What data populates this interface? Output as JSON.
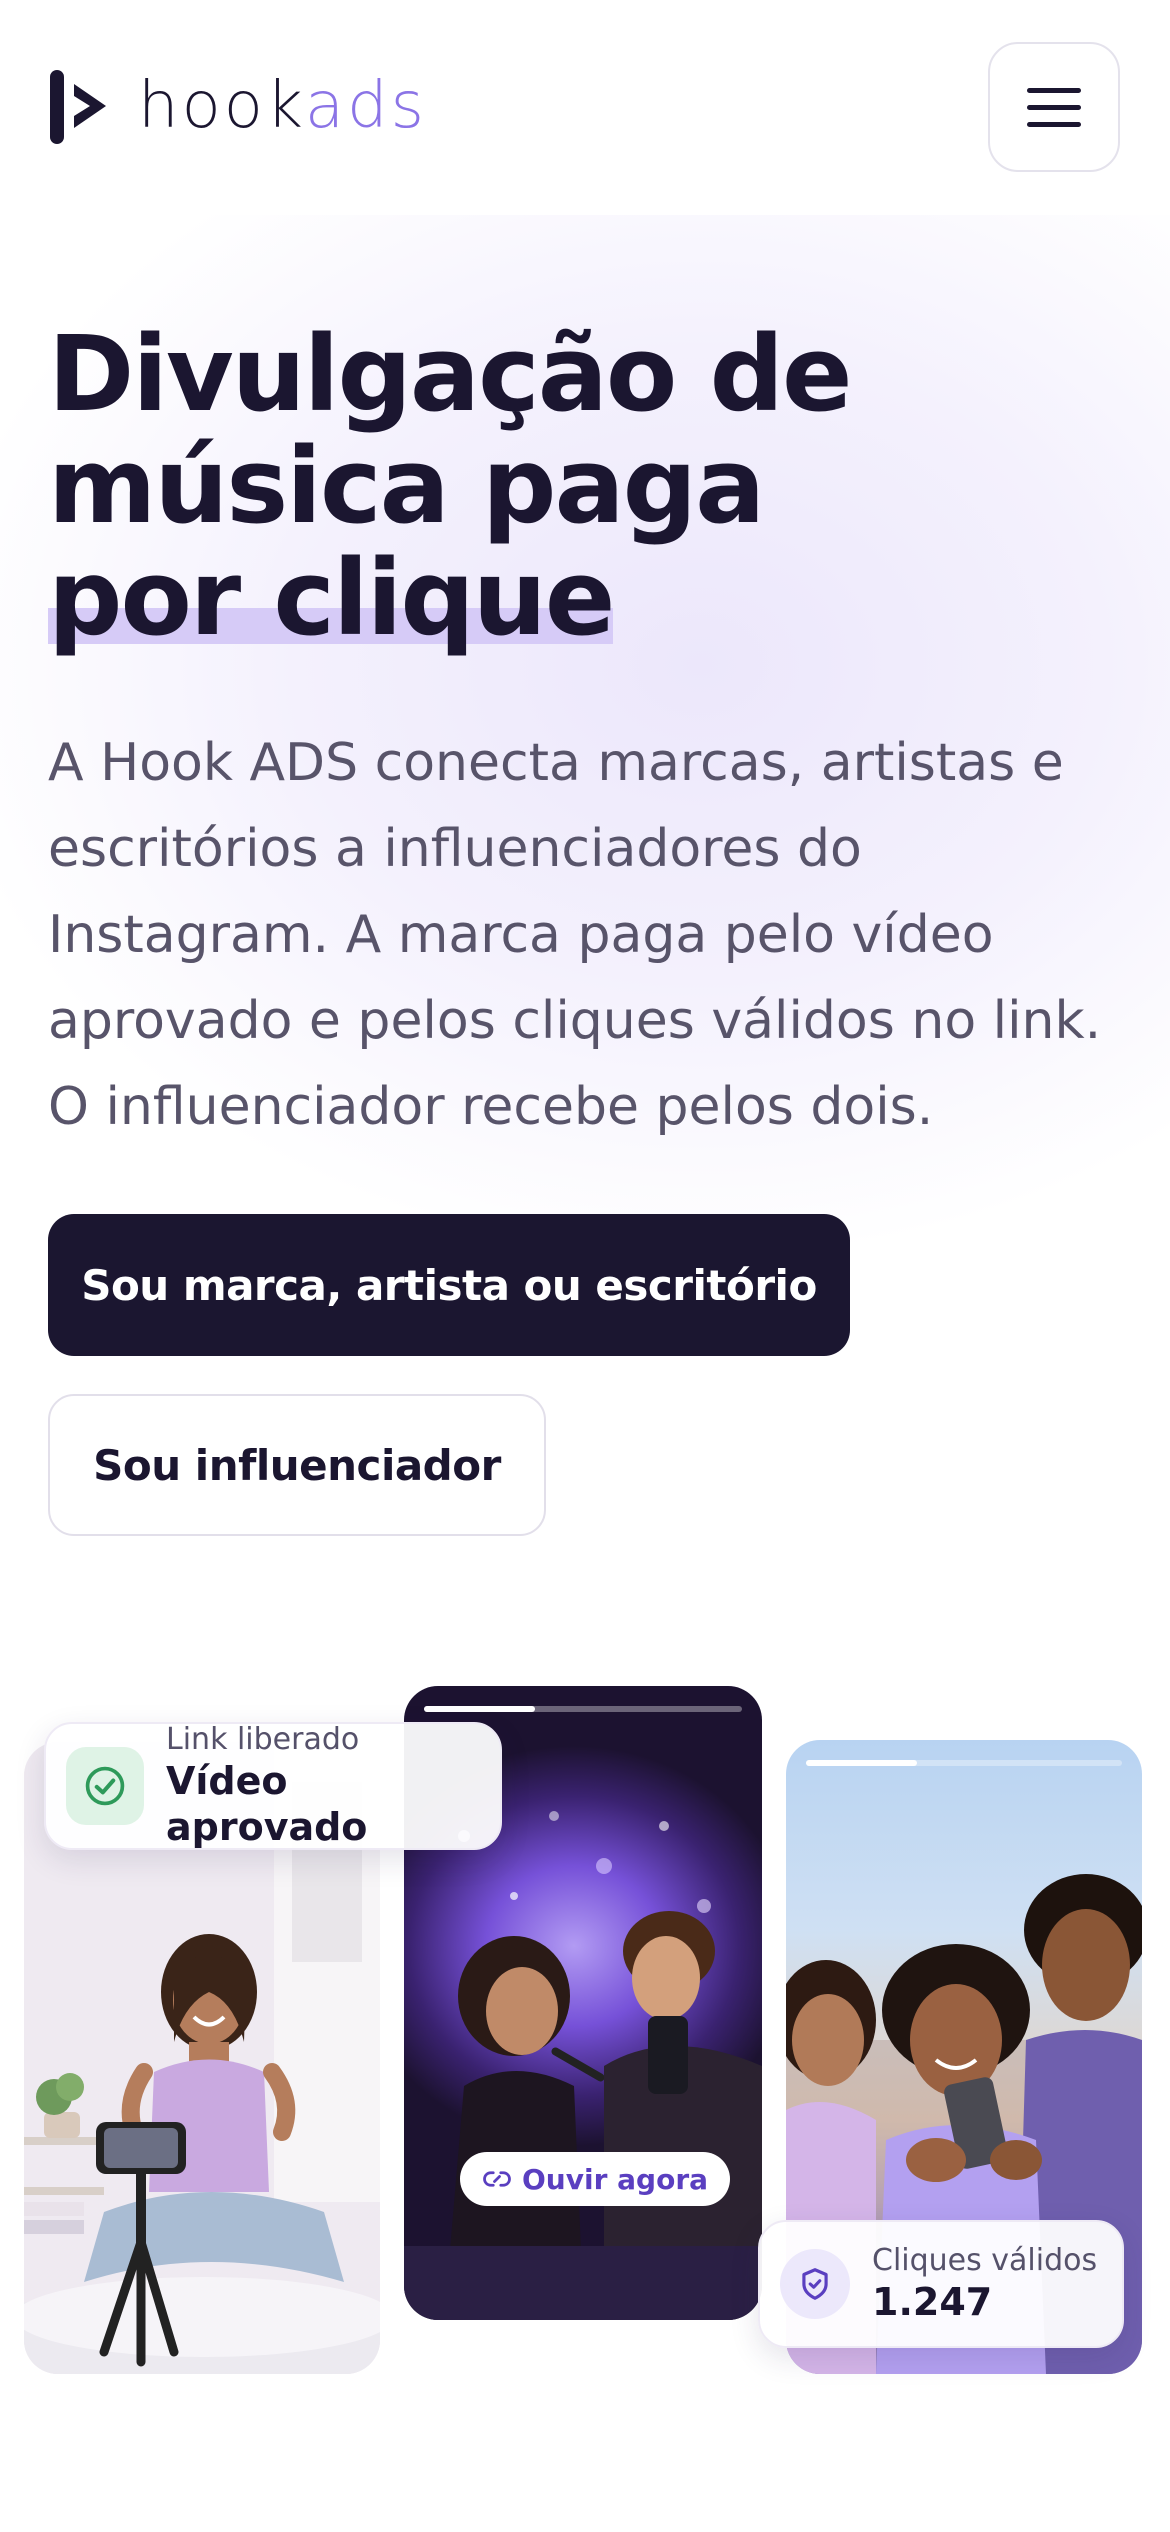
{
  "brand": {
    "name_part1": "hook",
    "name_part2": "ads",
    "accent_color": "#8b74e6",
    "dark_color": "#1b1630",
    "highlight_color": "#d6cbf7"
  },
  "header": {
    "menu_icon": "hamburger-menu-icon"
  },
  "hero": {
    "headline_line1": "Divulgação de",
    "headline_line2": "música paga",
    "headline_line3": "por clique",
    "description": "A Hook ADS conecta marcas, artistas e escritórios a influenciadores do Instagram. A marca paga pelo vídeo aprovado e pelos cliques válidos no link. O influenciador recebe pelos dois.",
    "primary_cta": "Sou marca, artista ou escritório",
    "secondary_cta": "Sou influenciador"
  },
  "cards": {
    "approved_badge": {
      "icon": "check-circle-icon",
      "small": "Link liberado",
      "big": "Vídeo aprovado"
    },
    "listen_pill": {
      "icon": "link-icon",
      "label": "Ouvir agora"
    },
    "clicks_badge": {
      "icon": "shield-check-icon",
      "small": "Cliques válidos",
      "big": "1.247"
    },
    "story_progress": [
      0.35,
      0.35
    ]
  }
}
